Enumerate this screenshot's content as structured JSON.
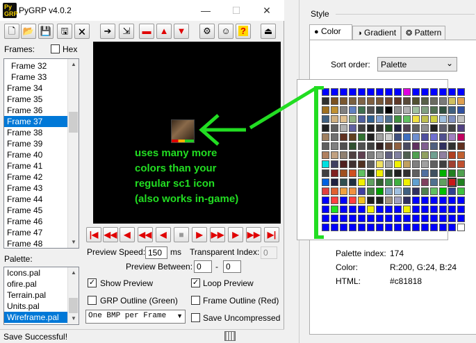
{
  "window": {
    "title": "PyGRP v4.0.2",
    "icon_text": "Py\nGRP"
  },
  "toolbar": [
    {
      "name": "new-file-icon",
      "glyph": "🗋"
    },
    {
      "name": "open-folder-icon",
      "glyph": "📂"
    },
    {
      "name": "save-icon",
      "glyph": "💾"
    },
    {
      "name": "save-as-icon",
      "glyph": "🖫"
    },
    {
      "name": "close-file-icon",
      "glyph": "🗙"
    },
    {
      "name": "export-frame-icon",
      "glyph": "➔"
    },
    {
      "name": "import-frame-icon",
      "glyph": "⇲"
    },
    {
      "name": "remove-frame-icon",
      "glyph": "▬"
    },
    {
      "name": "move-up-icon",
      "glyph": "▲"
    },
    {
      "name": "move-down-icon",
      "glyph": "▼"
    },
    {
      "name": "settings-icon",
      "glyph": "⚙"
    },
    {
      "name": "about-icon",
      "glyph": "☺"
    },
    {
      "name": "help-icon",
      "glyph": "?"
    },
    {
      "name": "exit-icon",
      "glyph": "⏏"
    }
  ],
  "frames": {
    "label": "Frames:",
    "hex_label": "Hex",
    "items": [
      "Frame 32",
      "Frame 33",
      "Frame 34",
      "Frame 35",
      "Frame 36",
      "Frame 37",
      "Frame 38",
      "Frame 39",
      "Frame 40",
      "Frame 41",
      "Frame 42",
      "Frame 43",
      "Frame 44",
      "Frame 45",
      "Frame 46",
      "Frame 47",
      "Frame 48"
    ],
    "selected": "Frame 37"
  },
  "palette": {
    "label": "Palette:",
    "items": [
      "Icons.pal",
      "ofire.pal",
      "Terrain.pal",
      "Units.pal",
      "Wireframe.pal"
    ],
    "selected": "Wireframe.pal"
  },
  "overlay_text": [
    "uses many more",
    "colors than your",
    "regular sc1 icon",
    "(also works in-game)"
  ],
  "playback": [
    "|◀",
    "◀◀",
    "◀",
    "◀◀",
    "◀",
    "■",
    "▶",
    "▶▶",
    "▶",
    "▶▶",
    "▶|"
  ],
  "settings": {
    "preview_speed_label": "Preview Speed:",
    "preview_speed_value": "150",
    "ms_label": "ms",
    "transparent_index_label": "Transparent Index:",
    "transparent_index_value": "0",
    "preview_between_label": "Preview Between:",
    "between_from": "0",
    "between_dash": "-",
    "between_to": "0",
    "show_preview": "Show Preview",
    "loop_preview": "Loop Preview",
    "grp_outline": "GRP Outline (Green)",
    "frame_outline": "Frame Outline (Red)",
    "output_mode": "One BMP per Frame",
    "save_uncompressed": "Save Uncompressed"
  },
  "status": "Save Successful!",
  "style_panel": {
    "group_label": "Style",
    "tabs": [
      "Color",
      "Gradient",
      "Pattern"
    ],
    "sort_label": "Sort order:",
    "sort_value": "Palette",
    "palette_index_label": "Palette index:",
    "palette_index_value": "174",
    "color_label": "Color:",
    "color_value": "R:200, G:24, B:24",
    "html_label": "HTML:",
    "html_value": "#c81818"
  },
  "colors": {
    "accent": "#0078d7",
    "overlay": "#22dd22",
    "selected_color": "#c81818"
  }
}
